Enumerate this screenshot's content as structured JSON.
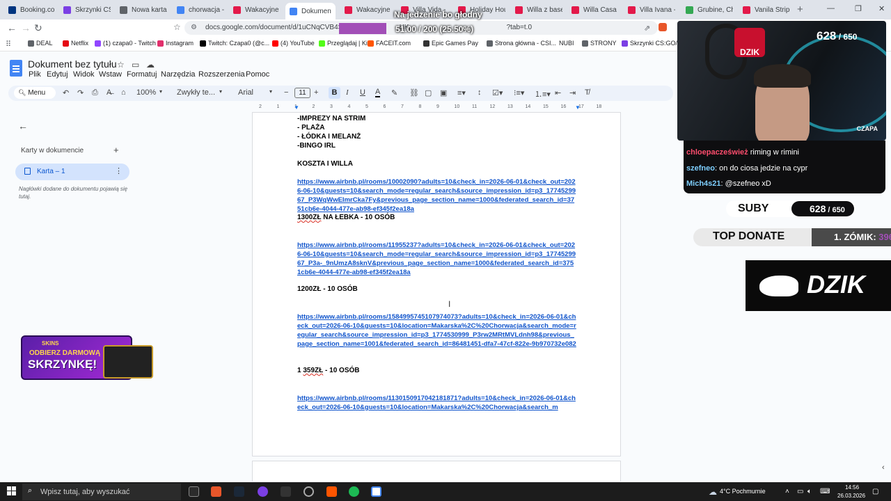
{
  "browser": {
    "tabs": [
      {
        "title": "Booking.com",
        "color": "#003580"
      },
      {
        "title": "Skrzynki CS:G",
        "color": "#7b3fe4"
      },
      {
        "title": "Nowa karta",
        "color": "#5f6368"
      },
      {
        "title": "chorwacja - S",
        "color": "#4285f4"
      },
      {
        "title": "Wakacyjne m",
        "color": "#e3194a"
      },
      {
        "title": "Dokumen",
        "color": "#4285f4",
        "active": true
      },
      {
        "title": "Wakacyjne m",
        "color": "#e3194a"
      },
      {
        "title": "Villa Vida - D",
        "color": "#e3194a"
      },
      {
        "title": "Holiday Hous",
        "color": "#e3194a"
      },
      {
        "title": "Willa z basen",
        "color": "#e3194a"
      },
      {
        "title": "Willa Casa N",
        "color": "#e3194a"
      },
      {
        "title": "Villa Ivana - D",
        "color": "#e3194a"
      },
      {
        "title": "Grubine, Chor",
        "color": "#34a853"
      },
      {
        "title": "Vanila Strip-C",
        "color": "#e3194a"
      }
    ],
    "url_start": "docs.google.com/document/d/1uCNqCVB4SPV",
    "url_mid": "HK",
    "url_end": "?tab=t.0",
    "bookmarks": [
      "DEAL",
      "Netflix",
      "(1) czapa0 - Twitch",
      "Instagram",
      "Twitch: Czapa0 (@c...",
      "(4) YouTube",
      "Przeglądaj | Kick",
      "FACEIT.com",
      "Epic Games Pay",
      "Strona główna - CSI...",
      "NUBI",
      "STRONY",
      "Skrzynki CS:GO/CS..."
    ]
  },
  "stream_overlay": {
    "title": "Na jedzenie bo głodny",
    "progress_text": "51.00 / 200 (25.50%)",
    "progress_fraction": 0.255,
    "subs_current": "628",
    "subs_goal": "650",
    "subs_label": "SUBY",
    "streamer_name": "CZAPA",
    "logo_text": "DZIK",
    "top_donate_label": "TOP DONATE",
    "top_donate_value": "1. ZÓMIK: ",
    "top_donate_amount": "396",
    "chat": [
      {
        "user": "chloepacześwież",
        "msg": "riming w rimini"
      },
      {
        "user": "szefneo",
        "msg": "on do ciosa jedzie na cypr"
      },
      {
        "user": "Mich4s21",
        "msg": "@szefneo xD"
      }
    ]
  },
  "docs": {
    "title": "Dokument bez tytułu",
    "menus": [
      "Plik",
      "Edytuj",
      "Widok",
      "Wstaw",
      "Formatuj",
      "Narzędzia",
      "Rozszerzenia",
      "Pomoc"
    ],
    "toolbar": {
      "search": "Menu",
      "zoom": "100%",
      "style": "Zwykły te...",
      "font": "Arial",
      "font_size": "11"
    },
    "ruler_marks": [
      "2",
      "1",
      "1",
      "2",
      "3",
      "4",
      "5",
      "6",
      "7",
      "8",
      "9",
      "10",
      "11",
      "12",
      "13",
      "14",
      "15",
      "16",
      "17",
      "18"
    ],
    "outline": {
      "heading": "Karty w dokumencie",
      "tab_label": "Karta – 1",
      "hint": "Nagłówki dodane do dokumentu pojawią się tutaj."
    },
    "promo": {
      "brand": "SKINS",
      "line1": "ODBIERZ DARMOWĄ",
      "line2": "SKRZYNKĘ!"
    },
    "content": {
      "l1": "-IMPREZY NA STRIM",
      "l2": "- PLAŻA",
      "l3": "- ŁÓDKA I MELANŻ",
      "l4": "-BINGO IRL",
      "l5": "KOSZTA I WILLA",
      "link1": "https://www.airbnb.pl/rooms/10002090?adults=10&check_in=2026-06-01&check_out=2026-06-10&guests=10&search_mode=regular_search&source_impression_id=p3_1774529967_P3WqWwEImrCka7Fy&previous_page_section_name=1000&federated_search_id=3751cb6e-4044-477e-ab98-ef345f2ea18a",
      "price1_a": "1300ZŁ",
      "price1_b": " NA ŁEBKA - 10 OSÓB",
      "link2": "https://www.airbnb.pl/rooms/11955237?adults=10&check_in=2026-06-01&check_out=2026-06-10&guests=10&search_mode=regular_search&source_impression_id=p3_1774529967_P3a-_9nUmzA8sknV&previous_page_section_name=1000&federated_search_id=3751cb6e-4044-477e-ab98-ef345f2ea18a",
      "price2": "1200ZŁ - 10 OSÓB",
      "link3": "https://www.airbnb.pl/rooms/1584995745107974073?adults=10&check_in=2026-06-01&check_out=2026-06-10&guests=10&location=Makarska%2C%20Chorwacja&search_mode=regular_search&source_impression_id=p3_1774530999_P3rw2MRtMVLdnh98&previous_page_section_name=1001&federated_search_id=86481451-dfa7-47cf-822e-9b970732e082",
      "price3_a": "1 ",
      "price3_b": "359ZŁ",
      "price3_c": " - 10 OSÓB",
      "link4": "https://www.airbnb.pl/rooms/1130150917042181871?adults=10&check_in=2026-06-01&check_out=2026-06-10&guests=10&location=Makarska%2C%20Chorwacja&search_m"
    }
  },
  "taskbar": {
    "search_placeholder": "Wpisz tutaj, aby wyszukać",
    "weather": "4°C  Pochmurnie",
    "time": "14:56",
    "date": "26.03.2026"
  }
}
